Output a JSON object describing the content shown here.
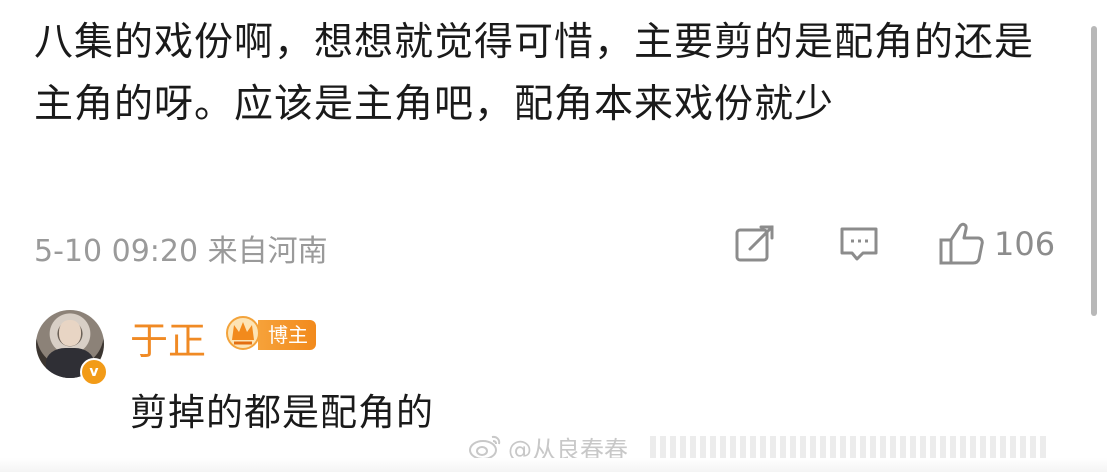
{
  "comment": {
    "text": "八集的戏份啊，想想就觉得可惜，主要剪的是配角的还是主角的呀。应该是主角吧，配角本来戏份就少",
    "meta": "5-10 09:20 来自河南",
    "like_count": "106",
    "icons": {
      "share": "share-icon",
      "reply": "comment-icon",
      "like": "thumbs-up-icon"
    }
  },
  "reply": {
    "author": "于正",
    "badge": "博主",
    "verified_mark": "v",
    "text": "剪掉的都是配角的"
  },
  "watermark": {
    "text": "@从良春春"
  },
  "colors": {
    "primary_text": "#1a1a1a",
    "meta_text": "#9a9a9a",
    "author_orange": "#f08a24",
    "badge_orange": "#f28a1c"
  }
}
